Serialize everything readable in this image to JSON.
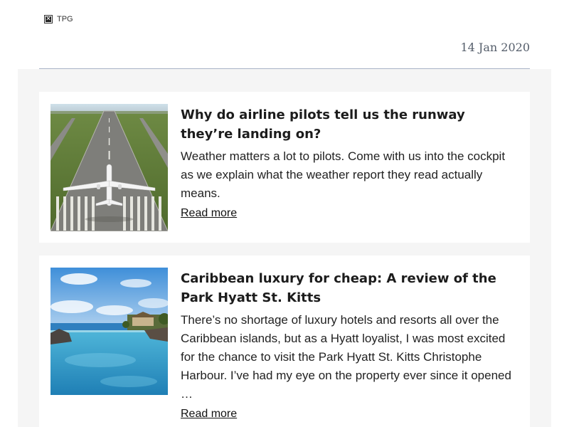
{
  "header": {
    "logo_text": "TPG",
    "date": "14 Jan 2020"
  },
  "articles": [
    {
      "title": "Why do airline pilots tell us the runway they’re landing on?",
      "description": "Weather matters a lot to pilots. Come with us into the cockpit as we explain what the weather report they read actually means.",
      "link_label": "Read more",
      "image_subject": "airplane-on-runway"
    },
    {
      "title": "Caribbean luxury for cheap: A review of the Park Hyatt St. Kitts",
      "description": "There’s no shortage of luxury hotels and resorts all over the Caribbean islands, but as a Hyatt loyalist, I was most excited for the chance to visit the Park Hyatt St. Kitts Christophe Harbour. I’ve had my eye on the property ever since it opened …",
      "link_label": "Read more",
      "image_subject": "resort-infinity-pool"
    }
  ]
}
